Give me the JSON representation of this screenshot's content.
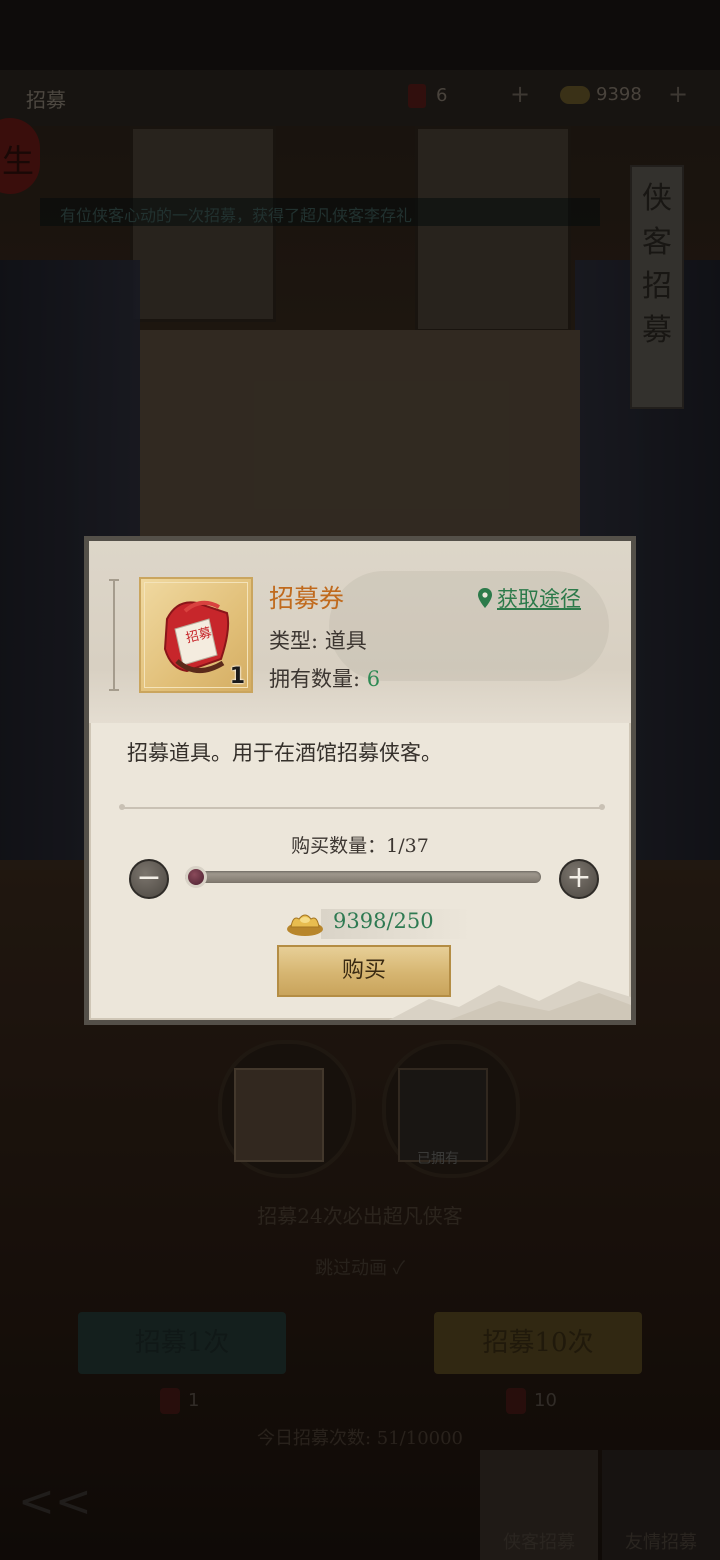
{
  "background": {
    "topbar": {
      "title": "招募",
      "recruit_tickets": "6",
      "gold": "9398"
    },
    "marquee": "有位侠客心动的一次招募，获得了超凡侠客李存礼",
    "banner": "侠客招募",
    "hero_owned_label": "已拥有",
    "guarantee_text": "招募24次必出超凡侠客",
    "skip_animation": "跳过动画 ✓",
    "recruit_1": {
      "label": "招募1次",
      "cost": "1"
    },
    "recruit_10": {
      "label": "招募10次",
      "cost": "10"
    },
    "today_count": "今日招募次数: 51/10000",
    "tabs": [
      {
        "label": "侠客招募"
      },
      {
        "label": "友情招募"
      }
    ]
  },
  "dialog": {
    "item": {
      "icon": "recruit-ticket-icon",
      "icon_text": "招募",
      "quantity_badge": "1",
      "name": "招募券",
      "type_text": "类型: 道具",
      "owned_label": "拥有数量: ",
      "owned_value": "6"
    },
    "source_link": "获取途径",
    "description": "招募道具。用于在酒馆招募侠客。",
    "buy_count": "购买数量：1/37",
    "slider": {
      "min": 1,
      "max": 37,
      "value": 1
    },
    "price": "9398/250",
    "buy_button": "购买"
  },
  "colors": {
    "item_name": "#c06a1d",
    "green_value": "#2e8a54",
    "buy_button": "#d6b571",
    "panel_bg": "#ece6da"
  }
}
